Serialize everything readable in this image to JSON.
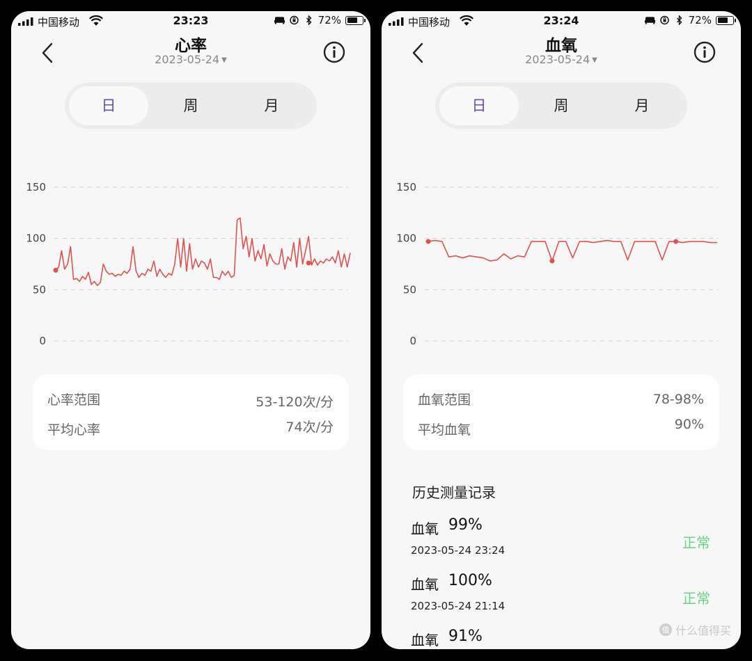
{
  "left": {
    "status": {
      "carrier": "中国移动",
      "time": "23:23",
      "battery": "72%",
      "battery_level": 0.72
    },
    "header": {
      "title": "心率",
      "date": "2023-05-24"
    },
    "tabs": [
      {
        "label": "日",
        "active": true
      },
      {
        "label": "周"
      },
      {
        "label": "月"
      }
    ],
    "summary": {
      "range_label": "心率范围",
      "range_value": "53-120次/分",
      "avg_label": "平均心率",
      "avg_value": "74次/分"
    }
  },
  "right": {
    "status": {
      "carrier": "中国移动",
      "time": "23:24",
      "battery": "72%",
      "battery_level": 0.72
    },
    "header": {
      "title": "血氧",
      "date": "2023-05-24"
    },
    "tabs": [
      {
        "label": "日",
        "active": true
      },
      {
        "label": "周"
      },
      {
        "label": "月"
      }
    ],
    "summary": {
      "range_label": "血氧范围",
      "range_value": "78-98%",
      "avg_label": "平均血氧",
      "avg_value": "90%"
    },
    "history": {
      "title": "历史测量记录",
      "records": [
        {
          "name": "血氧",
          "value": "99%",
          "time": "2023-05-24 23:24",
          "status": "正常"
        },
        {
          "name": "血氧",
          "value": "100%",
          "time": "2023-05-24 21:14",
          "status": "正常"
        },
        {
          "name": "血氧",
          "value": "91%"
        }
      ]
    },
    "watermark": "什么值得买"
  },
  "colors": {
    "line": "#e0524f",
    "accent": "#5a4fc4",
    "normal": "#6ad18a",
    "grid": "#cfcfcf"
  },
  "chart_data": [
    {
      "type": "line",
      "title": "",
      "ylim": [
        0,
        150
      ],
      "yticks": [
        0,
        50,
        100,
        150
      ],
      "grid": true,
      "x": [
        0,
        1,
        2,
        3,
        4,
        5,
        6,
        7,
        8,
        9,
        10,
        11,
        12,
        13,
        14,
        15,
        16,
        17,
        18,
        19,
        20,
        21,
        22,
        23,
        24,
        25,
        26,
        27,
        28,
        29,
        30,
        31,
        32,
        33,
        34,
        35,
        36,
        37,
        38,
        39,
        40,
        41,
        42,
        43,
        44,
        45,
        46,
        47,
        48,
        49,
        50,
        51,
        52,
        53,
        54,
        55,
        56,
        57,
        58,
        59,
        60,
        61,
        62,
        63,
        64,
        65,
        66,
        67,
        68,
        69,
        70,
        71,
        72,
        73,
        74,
        75,
        76,
        77,
        78,
        79,
        80,
        81,
        82,
        83,
        84,
        85,
        86,
        87,
        88,
        89,
        90,
        91,
        92,
        93,
        94,
        95,
        96,
        97,
        98,
        99
      ],
      "series": [
        {
          "values": [
            69,
            72,
            88,
            70,
            75,
            92,
            60,
            61,
            58,
            63,
            60,
            67,
            55,
            58,
            54,
            57,
            75,
            68,
            65,
            66,
            63,
            65,
            64,
            68,
            66,
            70,
            92,
            68,
            62,
            66,
            64,
            70,
            68,
            78,
            63,
            70,
            65,
            62,
            66,
            64,
            75,
            100,
            72,
            100,
            68,
            95,
            70,
            80,
            72,
            78,
            76,
            70,
            80,
            62,
            62,
            60,
            68,
            64,
            68,
            62,
            64,
            118,
            120,
            90,
            102,
            82,
            100,
            78,
            88,
            80,
            94,
            73,
            85,
            78,
            75,
            75,
            90,
            70,
            82,
            78,
            96,
            72,
            100,
            75,
            88,
            102,
            74,
            80,
            74,
            78,
            76,
            80,
            78,
            82,
            76,
            88,
            72,
            85,
            72,
            86
          ]
        }
      ],
      "markers": [
        {
          "x": 0,
          "y": 69
        },
        {
          "x": 85,
          "y": 76
        }
      ]
    },
    {
      "type": "line",
      "title": "",
      "ylim": [
        0,
        150
      ],
      "yticks": [
        0,
        50,
        100,
        150
      ],
      "grid": true,
      "x": [
        0,
        1,
        2,
        3,
        4,
        5,
        6,
        7,
        8,
        9,
        10,
        11,
        12,
        13,
        14,
        15,
        16,
        17,
        18,
        19,
        20,
        21,
        22,
        23,
        24,
        25,
        26,
        27,
        28,
        29,
        30,
        31,
        32,
        33,
        34,
        35,
        36,
        37,
        38,
        39,
        40,
        41,
        42
      ],
      "series": [
        {
          "values": [
            97,
            98,
            97,
            82,
            83,
            81,
            83,
            82,
            81,
            78,
            79,
            85,
            80,
            83,
            82,
            97,
            97,
            97,
            78,
            97,
            97,
            81,
            97,
            97,
            96,
            97,
            98,
            97,
            97,
            79,
            97,
            97,
            97,
            97,
            79,
            97,
            97,
            96,
            97,
            97,
            97,
            96,
            96
          ]
        }
      ],
      "markers": [
        {
          "x": 0,
          "y": 97
        },
        {
          "x": 18,
          "y": 78
        },
        {
          "x": 36,
          "y": 97
        }
      ]
    }
  ]
}
